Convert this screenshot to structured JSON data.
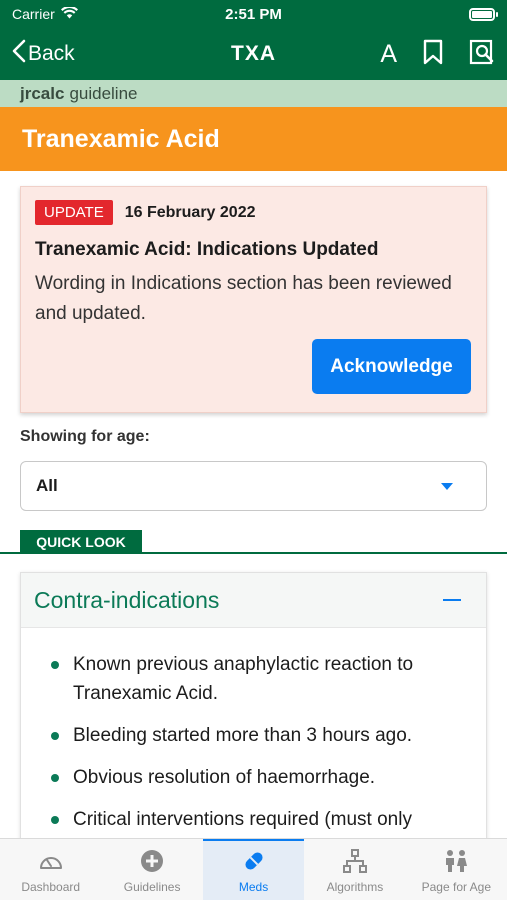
{
  "status": {
    "carrier": "Carrier",
    "time": "2:51 PM"
  },
  "nav": {
    "back_label": "Back",
    "title": "TXA",
    "font_label": "A"
  },
  "source": {
    "brand": "jrcalc",
    "type": "guideline"
  },
  "page": {
    "title": "Tranexamic Acid"
  },
  "update": {
    "badge": "UPDATE",
    "date": "16 February 2022",
    "title": "Tranexamic Acid: Indications Updated",
    "body": "Wording in Indications section has been reviewed and updated.",
    "button": "Acknowledge"
  },
  "age": {
    "label": "Showing for age:",
    "value": "All"
  },
  "quick_look": {
    "label": "QUICK LOOK"
  },
  "contra": {
    "title": "Contra-indications",
    "items": [
      "Known previous anaphylactic reaction to Tranexamic Acid.",
      "Bleeding started more than 3 hours ago.",
      "Obvious resolution of haemorrhage.",
      "Critical interventions required (must only"
    ]
  },
  "tabs": [
    {
      "label": "Dashboard",
      "icon": "dashboard-icon"
    },
    {
      "label": "Guidelines",
      "icon": "plus-circle-icon"
    },
    {
      "label": "Meds",
      "icon": "pill-icon",
      "active": true
    },
    {
      "label": "Algorithms",
      "icon": "algorithm-icon"
    },
    {
      "label": "Page for Age",
      "icon": "people-icon"
    }
  ],
  "colors": {
    "header_green": "#006b3f",
    "source_bar": "#bcdcc4",
    "title_orange": "#f7941d",
    "update_bg": "#fce9e4",
    "badge_red": "#e3272d",
    "accent_blue": "#0a7cf0",
    "section_green": "#0b7a57"
  }
}
